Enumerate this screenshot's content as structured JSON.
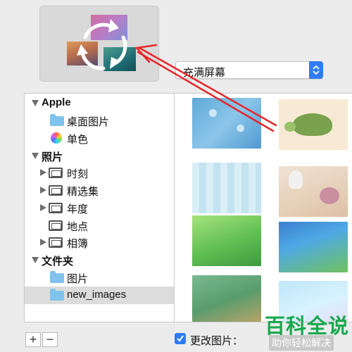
{
  "preview": {
    "icon": "rotate-cycle-icon"
  },
  "fill_select": {
    "selected": "充满屏幕",
    "icon": "up-down-stepper-icon"
  },
  "source_list": {
    "groups": [
      {
        "label": "Apple",
        "items": [
          "桌面图片",
          "单色"
        ]
      },
      {
        "label": "照片",
        "items": [
          "时刻",
          "精选集",
          "年度",
          "地点",
          "相簿"
        ]
      },
      {
        "label": "文件夹",
        "items": [
          "图片",
          "new_images"
        ]
      }
    ],
    "selected": "new_images"
  },
  "thumbnails": {
    "count": 8
  },
  "footer": {
    "add_label": "+",
    "remove_label": "−",
    "change_picture_label": "更改图片：",
    "change_picture_checked": true
  },
  "watermark": {
    "title": "百科全说",
    "subtitle": "助你轻松解决"
  },
  "colors": {
    "accent": "#2f7cf6",
    "arrow": "#e8262a",
    "watermark": "#18a84e"
  }
}
